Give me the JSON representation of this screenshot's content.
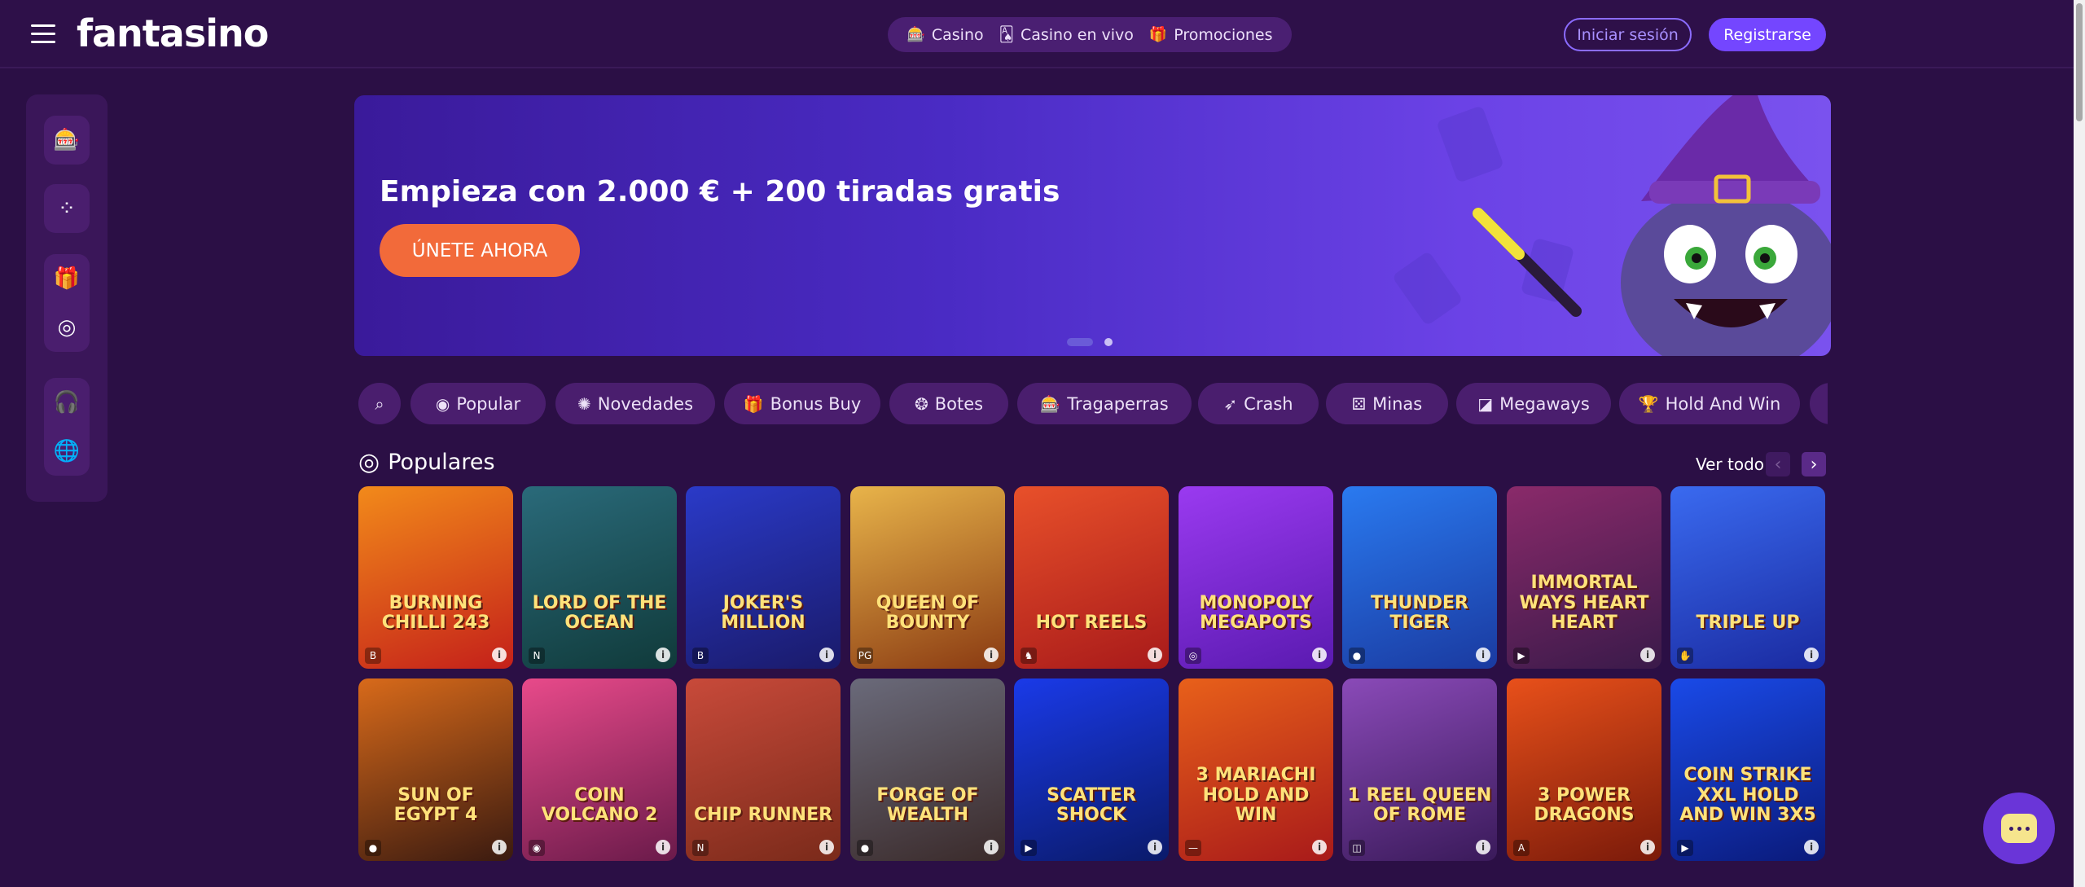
{
  "header": {
    "logo": "fantasino",
    "nav": [
      {
        "label": "Casino",
        "icon": "slot-machine-icon",
        "glyph": "🎰"
      },
      {
        "label": "Casino en vivo",
        "icon": "cards-icon",
        "glyph": "🂡"
      },
      {
        "label": "Promociones",
        "icon": "gift-icon",
        "glyph": "🎁"
      }
    ],
    "login_label": "Iniciar sesión",
    "register_label": "Registrarse"
  },
  "sidebar": {
    "icons": [
      {
        "name": "slot-machine-icon",
        "glyph": "🎰"
      },
      {
        "name": "sports-icon",
        "glyph": "⁘"
      },
      {
        "name": "gift-icon",
        "glyph": "🎁"
      },
      {
        "name": "chip-icon",
        "glyph": "◎"
      },
      {
        "name": "support-icon",
        "glyph": "🎧"
      },
      {
        "name": "globe-icon",
        "glyph": "🌐"
      }
    ]
  },
  "banner": {
    "title": "Empieza con 2.000 € + 200 tiradas gratis",
    "cta": "ÚNETE AHORA",
    "slides": 2,
    "active_slide": 1
  },
  "categories": [
    {
      "label": "",
      "icon": "search-icon",
      "glyph": "⌕"
    },
    {
      "label": "Popular",
      "icon": "spiral-icon",
      "glyph": "◉"
    },
    {
      "label": "Novedades",
      "icon": "new-icon",
      "glyph": "✺"
    },
    {
      "label": "Bonus Buy",
      "icon": "gift-icon",
      "glyph": "🎁"
    },
    {
      "label": "Botes",
      "icon": "jackpot-icon",
      "glyph": "❂"
    },
    {
      "label": "Tragaperras",
      "icon": "slot-machine-icon",
      "glyph": "🎰"
    },
    {
      "label": "Crash",
      "icon": "rocket-icon",
      "glyph": "➶"
    },
    {
      "label": "Minas",
      "icon": "dice-icon",
      "glyph": "⚄"
    },
    {
      "label": "Megaways",
      "icon": "megaways-icon",
      "glyph": "◪"
    },
    {
      "label": "Hold And Win",
      "icon": "trophy-icon",
      "glyph": "🏆"
    },
    {
      "label": "",
      "icon": "more-icon",
      "glyph": ""
    }
  ],
  "section": {
    "title": "Populares",
    "icon": "spiral-icon",
    "see_all": "Ver todo"
  },
  "games": [
    [
      {
        "name": "BURNING CHILLI 243",
        "provider": "B",
        "bg": "linear-gradient(160deg,#f28a1a,#c4201a)"
      },
      {
        "name": "LORD OF THE OCEAN",
        "provider": "N",
        "bg": "linear-gradient(160deg,#2a6a7a,#103a3a)"
      },
      {
        "name": "JOKER'S MILLION",
        "provider": "B",
        "bg": "linear-gradient(160deg,#2a3ac8,#1a1a6a)"
      },
      {
        "name": "QUEEN OF BOUNTY",
        "provider": "PG",
        "bg": "linear-gradient(160deg,#e8b44a,#8a3a12)"
      },
      {
        "name": "HOT REELS",
        "provider": "♞",
        "bg": "linear-gradient(160deg,#e8502a,#a81a1a)"
      },
      {
        "name": "MONOPOLY MEGAPOTS",
        "provider": "◎",
        "bg": "linear-gradient(160deg,#9a3af0,#5a1ab0)"
      },
      {
        "name": "THUNDER TIGER",
        "provider": "●",
        "bg": "linear-gradient(160deg,#2a7af0,#1a3aa0)"
      },
      {
        "name": "IMMORTAL WAYS HEART HEART",
        "provider": "▶",
        "bg": "linear-gradient(160deg,#8a2a6a,#3a1a4a)"
      },
      {
        "name": "TRIPLE UP",
        "provider": "✋",
        "bg": "linear-gradient(160deg,#3a6af0,#1a2aa0)"
      }
    ],
    [
      {
        "name": "SUN OF EGYPT 4",
        "provider": "●",
        "bg": "linear-gradient(160deg,#d86a1a,#3a1a10)"
      },
      {
        "name": "COIN VOLCANO 2",
        "provider": "◉",
        "bg": "linear-gradient(160deg,#e84a8a,#6a1a4a)"
      },
      {
        "name": "CHIP RUNNER",
        "provider": "N",
        "bg": "linear-gradient(160deg,#c84a3a,#7a2a1a)"
      },
      {
        "name": "FORGE OF WEALTH",
        "provider": "●",
        "bg": "linear-gradient(160deg,#6a6a7a,#3a2a2a)"
      },
      {
        "name": "SCATTER SHOCK",
        "provider": "▶",
        "bg": "linear-gradient(160deg,#1a3ae8,#0a1a6a)"
      },
      {
        "name": "3 MARIACHI HOLD AND WIN",
        "provider": "—",
        "bg": "linear-gradient(160deg,#e8601a,#a81a1a)"
      },
      {
        "name": "1 REEL QUEEN OF ROME",
        "provider": "◫",
        "bg": "linear-gradient(160deg,#8a4ab8,#3a1a5a)"
      },
      {
        "name": "3 POWER DRAGONS",
        "provider": "A",
        "bg": "linear-gradient(160deg,#e8501a,#7a1a0a)"
      },
      {
        "name": "COIN STRIKE XXL HOLD AND WIN 3X5",
        "provider": "▶",
        "bg": "linear-gradient(160deg,#1a4ae8,#0a1a7a)"
      }
    ]
  ],
  "colors": {
    "background": "#2b0f45",
    "accent": "#7446ff",
    "cta": "#f26a3a"
  }
}
